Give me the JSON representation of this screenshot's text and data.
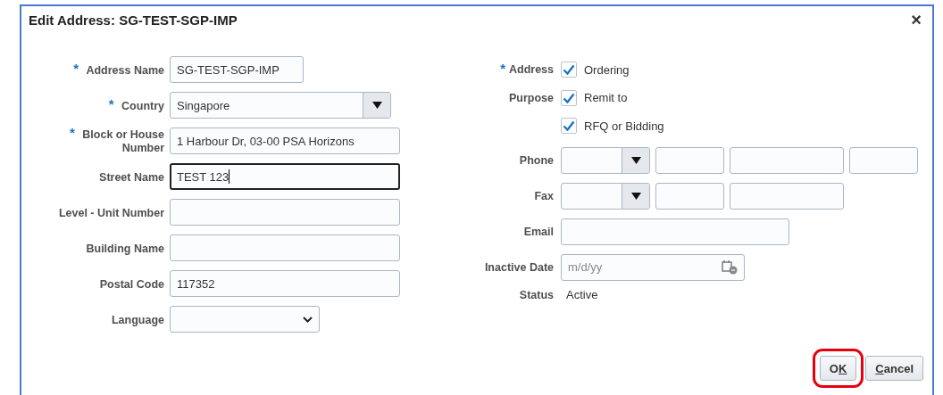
{
  "dialog": {
    "title": "Edit Address: SG-TEST-SGP-IMP",
    "close": "×"
  },
  "left_fields": [
    {
      "label": "Address Name",
      "required_mark": "*",
      "kind": "text",
      "value": "SG-TEST-SGP-IMP",
      "focused": false
    },
    {
      "label": "Country",
      "required_mark": "*",
      "kind": "combo",
      "value": "Singapore",
      "focused": false
    },
    {
      "label": "Block or House Number",
      "required_mark": "*",
      "kind": "text",
      "value": "1 Harbour Dr, 03-00 PSA Horizons",
      "focused": false
    },
    {
      "label": "Street Name",
      "kind": "text",
      "value": "TEST 123",
      "focused": true
    },
    {
      "label": "Level - Unit Number",
      "kind": "text",
      "focused": false
    },
    {
      "label": "Building Name",
      "kind": "text",
      "focused": false
    },
    {
      "label": "Postal Code",
      "kind": "text",
      "value": "117352",
      "focused": false
    },
    {
      "label": "Language",
      "kind": "select",
      "focused": false
    }
  ],
  "purpose": {
    "label_lines": [
      "Address",
      "Purpose"
    ],
    "required_mark": "*",
    "options": [
      {
        "label": "Ordering",
        "checked": true
      },
      {
        "label": "Remit to",
        "checked": true
      },
      {
        "label": "RFQ or Bidding",
        "checked": true
      }
    ]
  },
  "right_fields": [
    {
      "label": "Phone",
      "kind": "phone"
    },
    {
      "label": "Fax",
      "kind": "fax"
    },
    {
      "label": "Email",
      "kind": "text"
    },
    {
      "label": "Inactive Date",
      "kind": "date",
      "placeholder": "m/d/yy"
    },
    {
      "label": "Status",
      "kind": "readonly",
      "value": "Active"
    }
  ],
  "buttons": [
    {
      "label_parts": [
        {
          "text": "O",
          "underlined": false
        },
        {
          "text": "K",
          "underlined": true
        }
      ],
      "highlighted": true
    },
    {
      "label_parts": [
        {
          "text": "C",
          "underlined": true
        },
        {
          "text": "ancel",
          "underlined": false
        }
      ],
      "highlighted": false
    }
  ]
}
